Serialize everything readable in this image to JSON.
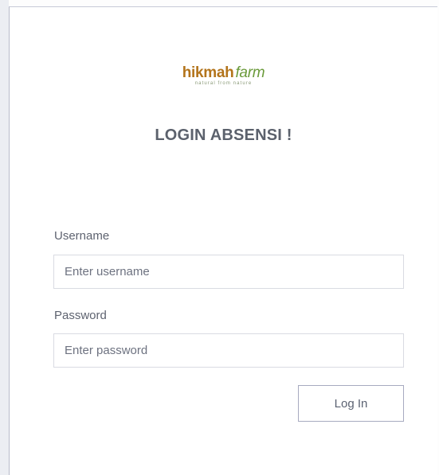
{
  "logo": {
    "brand_bold": "hikmah",
    "brand_italic": "farm",
    "tagline": "natural from nature"
  },
  "page_title": "LOGIN ABSENSI !",
  "form": {
    "username_label": "Username",
    "username_placeholder": "Enter username",
    "username_value": "",
    "password_label": "Password",
    "password_placeholder": "Enter password",
    "password_value": "",
    "submit_label": "Log In"
  },
  "colors": {
    "brand_orange": "#b3741b",
    "brand_green": "#6a9a3a",
    "title_text": "#5b616c",
    "button_border": "#a7aac0"
  }
}
